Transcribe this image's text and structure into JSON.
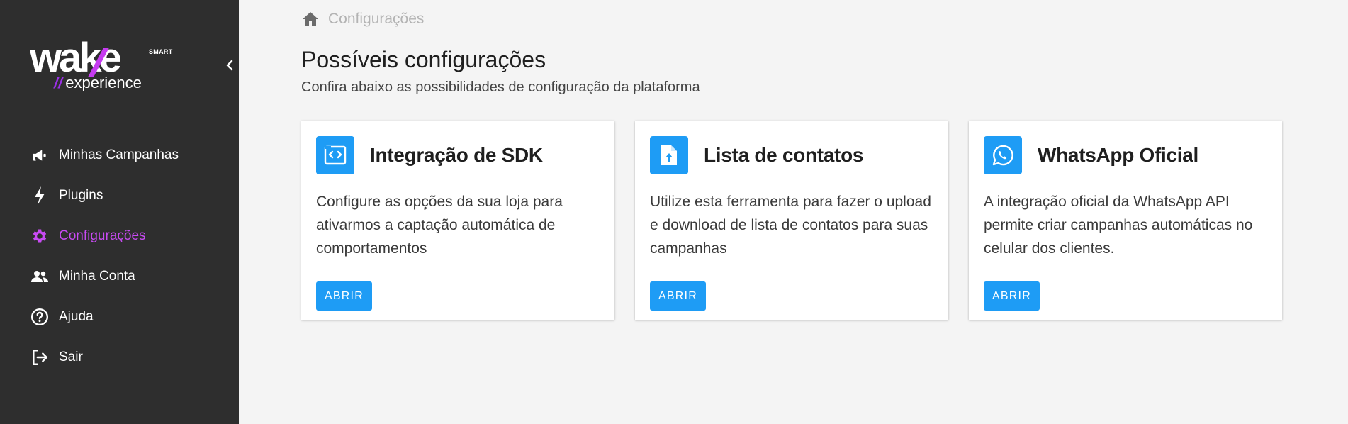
{
  "brand": {
    "word_left": "wa",
    "word_k": "k",
    "word_right": "e",
    "badge": "SMART",
    "sub_bars": "//",
    "sub_text": "experience",
    "accent_color": "#c94bf4"
  },
  "sidebar": {
    "items": [
      {
        "label": "Minhas Campanhas",
        "icon": "megaphone-icon"
      },
      {
        "label": "Plugins",
        "icon": "bolt-icon"
      },
      {
        "label": "Configurações",
        "icon": "gear-icon",
        "active": true
      },
      {
        "label": "Minha Conta",
        "icon": "people-icon"
      },
      {
        "label": "Ajuda",
        "icon": "help-circle-icon"
      },
      {
        "label": "Sair",
        "icon": "logout-icon"
      }
    ]
  },
  "breadcrumb": {
    "current": "Configurações"
  },
  "page": {
    "title": "Possíveis configurações",
    "subtitle": "Confira abaixo as possibilidades de configuração da plataforma"
  },
  "cards": [
    {
      "title": "Integração de SDK",
      "icon": "code-window-icon",
      "description": "Configure as opções da sua loja para ativarmos a captação automática de comportamentos",
      "button": "ABRIR"
    },
    {
      "title": "Lista de contatos",
      "icon": "file-upload-icon",
      "description": "Utilize esta ferramenta para fazer o upload e download de lista de contatos para suas campanhas",
      "button": "ABRIR"
    },
    {
      "title": "WhatsApp Oficial",
      "icon": "whatsapp-icon",
      "description": "A integração oficial da WhatsApp API permite criar campanhas automáticas no celular dos clientes.",
      "button": "ABRIR"
    }
  ],
  "colors": {
    "sidebar_bg": "#2e2e2e",
    "primary": "#1e9cf5",
    "page_bg": "#f4f4f4"
  }
}
